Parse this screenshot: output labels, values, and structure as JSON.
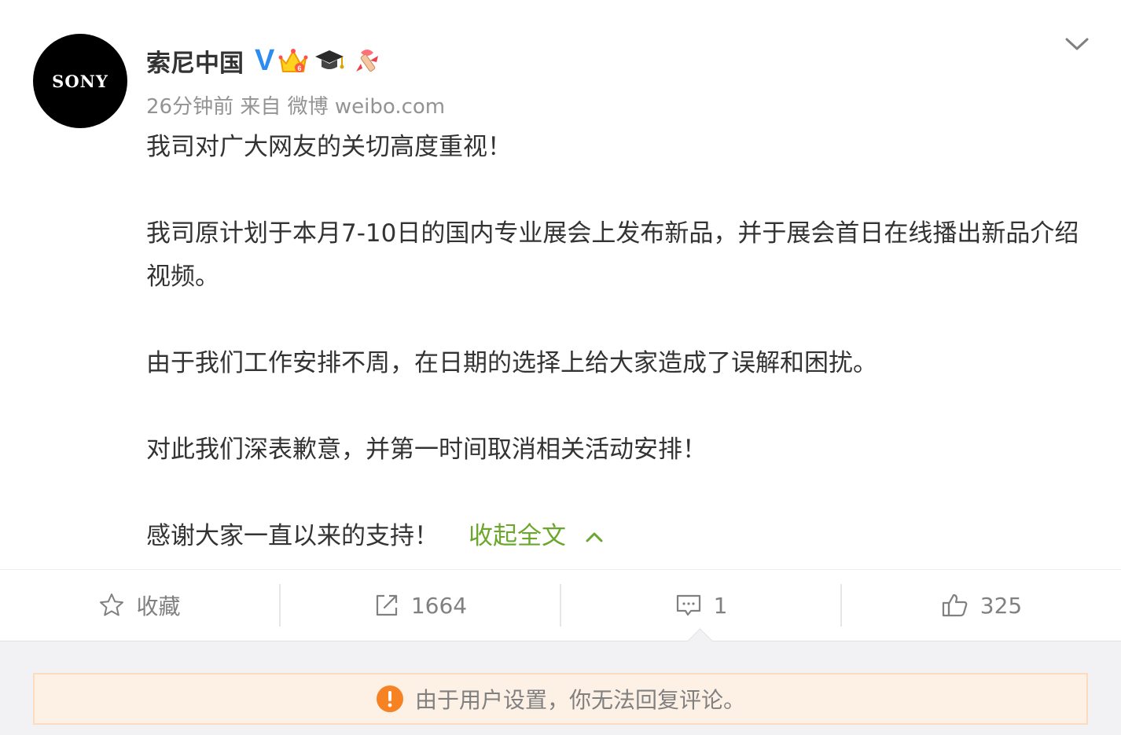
{
  "user": {
    "avatar_text": "SONY",
    "name": "索尼中国",
    "verified_mark": "V",
    "badges": [
      "crown-icon",
      "graduation-cap-icon",
      "ribbon-icon"
    ]
  },
  "meta": {
    "time": "26分钟前",
    "source": "来自 微博 weibo.com"
  },
  "post": {
    "paragraphs": [
      "我司对广大网友的关切高度重视！",
      "我司原计划于本月7-10日的国内专业展会上发布新品，并于展会首日在线播出新品介绍视频。",
      "由于我们工作安排不周，在日期的选择上给大家造成了误解和困扰。",
      "对此我们深表歉意，并第一时间取消相关活动安排！",
      "感谢大家一直以来的支持！"
    ],
    "collapse_label": "收起全文"
  },
  "actions": {
    "favorite_label": "收藏",
    "repost_count": "1664",
    "comment_count": "1",
    "like_count": "325"
  },
  "notice": {
    "text": "由于用户设置，你无法回复评论。"
  },
  "colors": {
    "verified": "#2d8cf0",
    "link": "#6aa72c",
    "warning": "#f78224",
    "notice_bg": "#fdf1e6"
  }
}
